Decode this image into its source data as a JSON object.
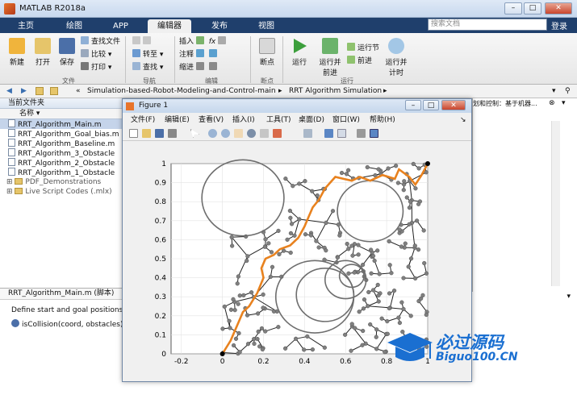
{
  "app": {
    "title": "MATLAB R2018a",
    "search_placeholder": "搜索文档",
    "login": "登录"
  },
  "tabs": [
    {
      "label": "主页"
    },
    {
      "label": "绘图"
    },
    {
      "label": "APP"
    },
    {
      "label": "编辑器"
    },
    {
      "label": "发布"
    },
    {
      "label": "视图"
    }
  ],
  "ribbon": {
    "file": {
      "new": "新建",
      "open": "打开",
      "save": "保存",
      "find_files": "查找文件",
      "compare": "比较",
      "print": "打印",
      "section": "文件"
    },
    "nav": {
      "goto": "转至",
      "find": "查找",
      "section": "导航"
    },
    "edit": {
      "insert": "插入",
      "comment": "注释",
      "indent": "缩进",
      "section": "编辑"
    },
    "breakpoints": {
      "label": "断点",
      "section": "断点"
    },
    "run": {
      "run": "运行",
      "run_advance": "运行并前进",
      "run_section": "运行节",
      "advance": "前进",
      "run_time": "运行并计时",
      "section": "运行"
    }
  },
  "address": {
    "prefix": "«",
    "path1": "Simulation-based-Robot-Modeling-and-Control-main",
    "path2": "RRT Algorithm Simulation"
  },
  "current_folder": {
    "title": "当前文件夹",
    "col_name": "名称",
    "files": [
      "RRT_Algorithm_Main.m",
      "RRT_Algorithm_Goal_bias.m",
      "RRT_Algorithm_Baseline.m",
      "RRT_Algorithm_3_Obstacle",
      "RRT_Algorithm_2_Obstacle",
      "RRT_Algorithm_1_Obstacle"
    ],
    "folders": [
      "PDF_Demonstrations",
      "Live Script Codes (.mlx)"
    ]
  },
  "detail": {
    "title": "RRT_Algorithm_Main.m  (脚本)",
    "line1": "Define start and goal positions",
    "line2": "isCollision(coord, obstacles)"
  },
  "editor_tab_fragment": "划和控制：基于机器...",
  "figure": {
    "title": "Figure 1",
    "menu": [
      "文件(F)",
      "编辑(E)",
      "查看(V)",
      "插入(I)",
      "工具(T)",
      "桌面(D)",
      "窗口(W)",
      "帮助(H)"
    ]
  },
  "chart_data": {
    "type": "scatter",
    "xlim": [
      -0.25,
      1.0
    ],
    "ylim": [
      0,
      1
    ],
    "xticks": [
      -0.2,
      0,
      0.2,
      0.4,
      0.6,
      0.8,
      1
    ],
    "yticks": [
      0,
      0.1,
      0.2,
      0.3,
      0.4,
      0.5,
      0.6,
      0.7,
      0.8,
      0.9,
      1
    ],
    "xtick_labels": [
      "-0.2",
      "0",
      "0.2",
      "0.4",
      "0.6",
      "0.8",
      "1"
    ],
    "ytick_labels": [
      "0",
      "0.1",
      "0.2",
      "0.3",
      "0.4",
      "0.5",
      "0.6",
      "0.7",
      "0.8",
      "0.9",
      "1"
    ],
    "grid": true,
    "obstacles": [
      {
        "cx": 0.1,
        "cy": 0.82,
        "r": 0.2
      },
      {
        "cx": 0.72,
        "cy": 0.75,
        "r": 0.16
      },
      {
        "cx": 0.45,
        "cy": 0.3,
        "r": 0.19
      },
      {
        "cx": 0.5,
        "cy": 0.31,
        "r": 0.14
      },
      {
        "cx": 0.6,
        "cy": 0.39,
        "r": 0.1
      },
      {
        "cx": 0.63,
        "cy": 0.41,
        "r": 0.06
      }
    ],
    "start": [
      0,
      0
    ],
    "goal": [
      1,
      1
    ],
    "path_x": [
      0,
      0.04,
      0.06,
      0.08,
      0.1,
      0.13,
      0.17,
      0.2,
      0.19,
      0.21,
      0.25,
      0.28,
      0.33,
      0.37,
      0.4,
      0.42,
      0.44,
      0.47,
      0.5,
      0.55,
      0.59,
      0.63,
      0.67,
      0.72,
      0.78,
      0.84,
      0.86,
      0.91,
      0.94,
      0.97,
      1
    ],
    "path_y": [
      0,
      0.07,
      0.12,
      0.17,
      0.22,
      0.25,
      0.32,
      0.4,
      0.45,
      0.5,
      0.52,
      0.55,
      0.57,
      0.61,
      0.67,
      0.72,
      0.77,
      0.81,
      0.87,
      0.93,
      0.92,
      0.91,
      0.93,
      0.91,
      0.94,
      0.92,
      0.97,
      0.93,
      0.89,
      0.94,
      1
    ]
  },
  "watermark": {
    "text1": "必过源码",
    "text2": "Biguo100.CN",
    "accent": "#1a6fd1"
  },
  "colors": {
    "path": "#e8821f",
    "tree": "#222222",
    "node": "#7f7f7f",
    "obstacle": "#6e6e6e"
  }
}
